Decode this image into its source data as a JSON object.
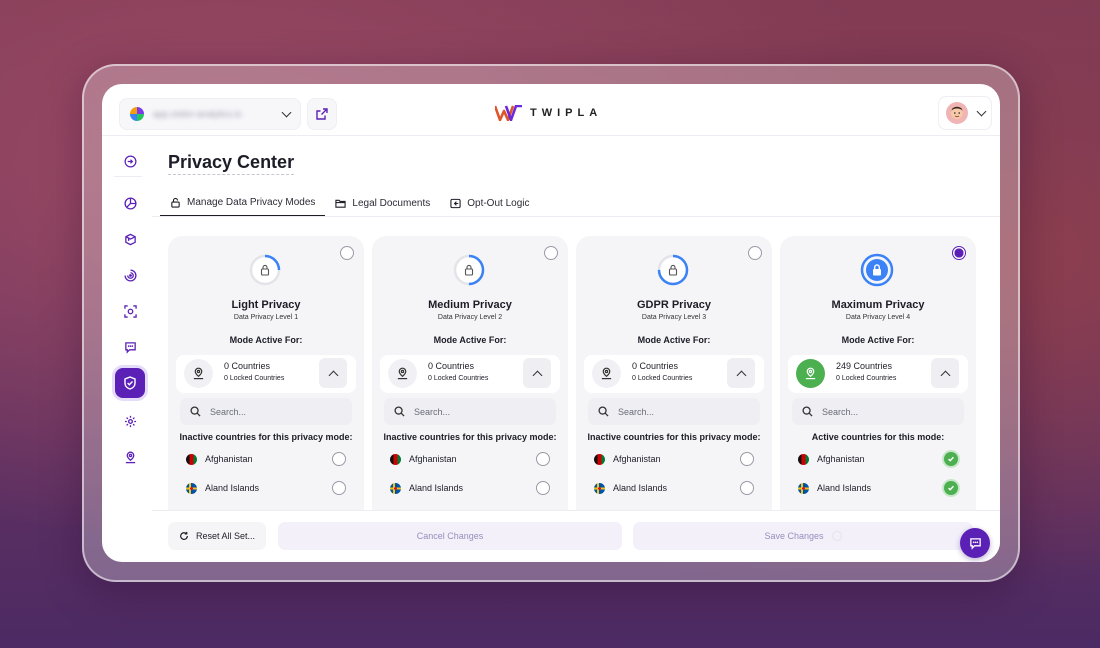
{
  "header": {
    "site_select": {
      "value": "app.visitor-analytics.io",
      "icon": "globe-icon"
    },
    "brand": "TWIPLA",
    "external_link_icon": "external-link-icon",
    "user_avatar_icon": "avatar-face"
  },
  "sidebar": {
    "items": [
      {
        "name": "collapse-sidebar",
        "icon": "collapse-icon"
      },
      {
        "name": "dashboard",
        "icon": "pie-chart-icon"
      },
      {
        "name": "analytics",
        "icon": "box-icon"
      },
      {
        "name": "behaviour",
        "icon": "target-icon"
      },
      {
        "name": "recordings",
        "icon": "camera-focus-icon"
      },
      {
        "name": "feedback",
        "icon": "chat-icon"
      },
      {
        "name": "privacy",
        "icon": "shield-check-icon",
        "active": true
      },
      {
        "name": "settings",
        "icon": "gear-icon"
      },
      {
        "name": "location",
        "icon": "location-pin-icon"
      }
    ]
  },
  "page": {
    "title": "Privacy Center",
    "tabs": [
      {
        "label": "Manage Data Privacy Modes",
        "icon": "lock-icon",
        "active": true
      },
      {
        "label": "Legal Documents",
        "icon": "folder-icon"
      },
      {
        "label": "Opt-Out Logic",
        "icon": "opt-out-icon"
      }
    ]
  },
  "cards": [
    {
      "title": "Light Privacy",
      "level": "Data Privacy Level 1",
      "mode_label": "Mode Active For:",
      "countries": "0 Countries",
      "locked": "0 Locked Countries",
      "search_placeholder": "Search...",
      "list_heading": "Inactive countries for this privacy mode:",
      "selected": false,
      "ring_fill": 0.25,
      "countries_list": [
        {
          "name": "Afghanistan",
          "checked": false
        },
        {
          "name": "Aland Islands",
          "checked": false
        }
      ]
    },
    {
      "title": "Medium Privacy",
      "level": "Data Privacy Level 2",
      "mode_label": "Mode Active For:",
      "countries": "0 Countries",
      "locked": "0 Locked Countries",
      "search_placeholder": "Search...",
      "list_heading": "Inactive countries for this privacy mode:",
      "selected": false,
      "ring_fill": 0.5,
      "countries_list": [
        {
          "name": "Afghanistan",
          "checked": false
        },
        {
          "name": "Aland Islands",
          "checked": false
        }
      ]
    },
    {
      "title": "GDPR Privacy",
      "level": "Data Privacy Level 3",
      "mode_label": "Mode Active For:",
      "countries": "0 Countries",
      "locked": "0 Locked Countries",
      "search_placeholder": "Search...",
      "list_heading": "Inactive countries for this privacy mode:",
      "selected": false,
      "ring_fill": 0.75,
      "countries_list": [
        {
          "name": "Afghanistan",
          "checked": false
        },
        {
          "name": "Aland Islands",
          "checked": false
        }
      ]
    },
    {
      "title": "Maximum Privacy",
      "level": "Data Privacy Level 4",
      "mode_label": "Mode Active For:",
      "countries": "249 Countries",
      "locked": "0 Locked Countries",
      "search_placeholder": "Search...",
      "list_heading": "Active countries for this mode:",
      "selected": true,
      "ring_fill": 1,
      "countries_list": [
        {
          "name": "Afghanistan",
          "checked": true
        },
        {
          "name": "Aland Islands",
          "checked": true
        }
      ]
    }
  ],
  "footer": {
    "reset_label": "Reset All Set...",
    "cancel_label": "Cancel Changes",
    "save_label": "Save Changes"
  },
  "colors": {
    "accent": "#5b21b6",
    "active_green": "#4caf50",
    "ring_blue": "#3b82f6"
  }
}
